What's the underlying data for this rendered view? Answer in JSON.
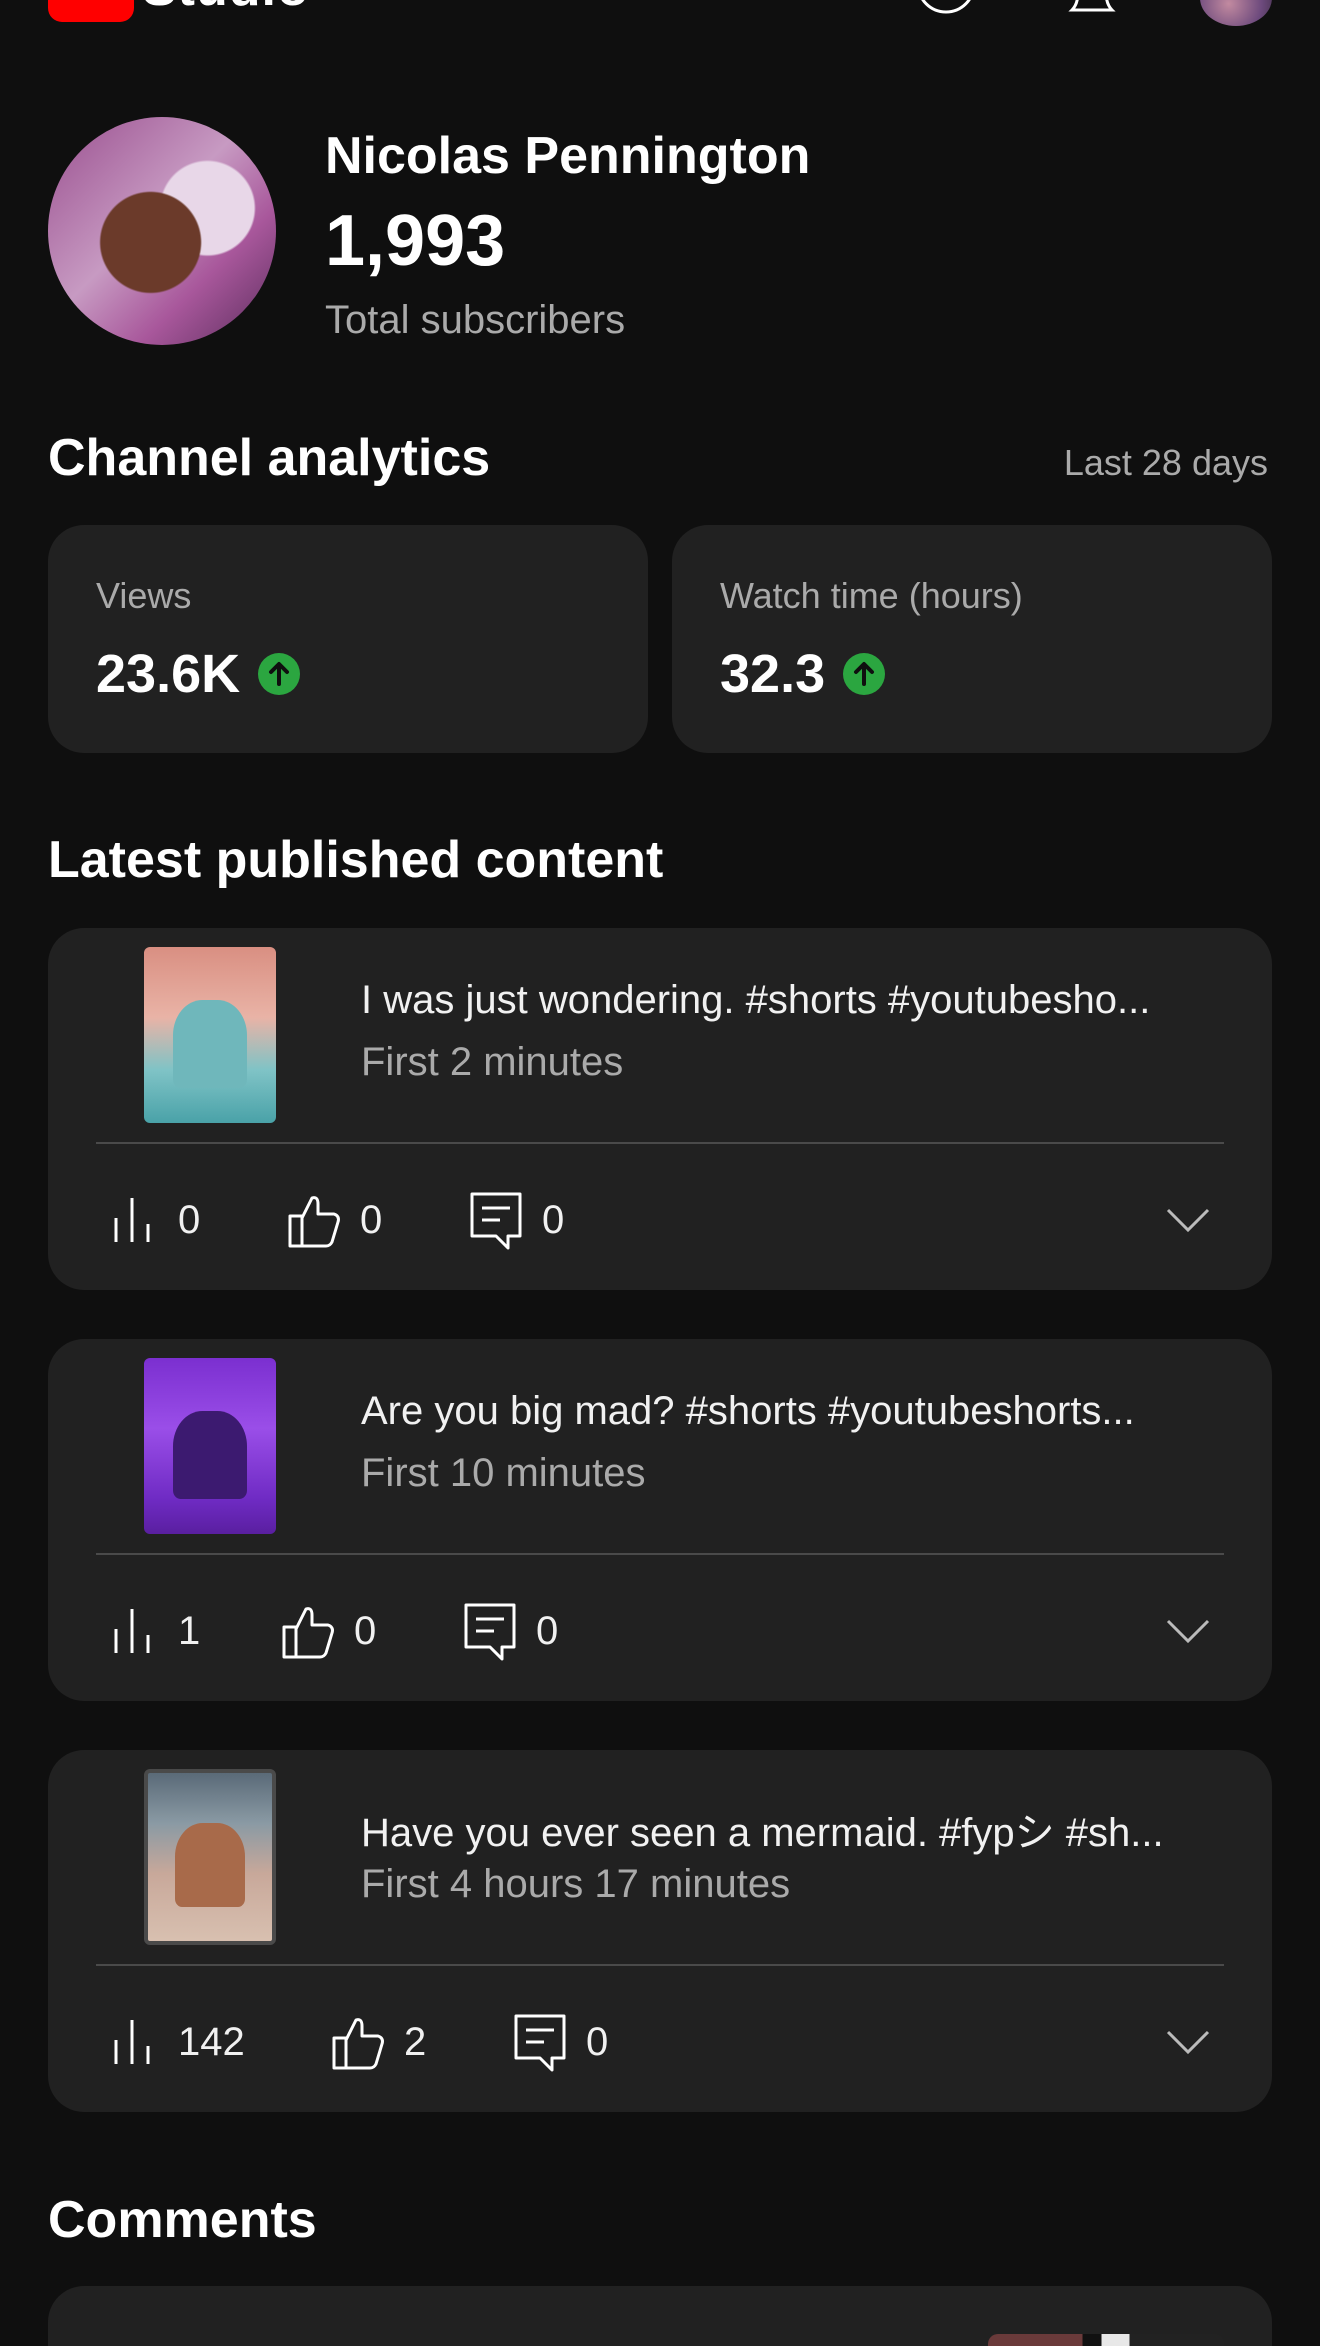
{
  "app": {
    "logo_text": "Studio"
  },
  "channel": {
    "name": "Nicolas Pennington",
    "subscribers": "1,993",
    "subscribers_label": "Total subscribers"
  },
  "analytics": {
    "title": "Channel analytics",
    "period": "Last 28 days",
    "stats": [
      {
        "label": "Views",
        "value": "23.6K",
        "trend": "up"
      },
      {
        "label": "Watch time (hours)",
        "value": "32.3",
        "trend": "up"
      }
    ],
    "trend_color": "#2ba640"
  },
  "latest": {
    "title": "Latest published content",
    "videos": [
      {
        "title": "I was just wondering. #shorts #youtubesho...",
        "subtitle": "First 2 minutes",
        "views": "0",
        "likes": "0",
        "comments": "0"
      },
      {
        "title": "Are you big mad? #shorts #youtubeshorts...",
        "subtitle": "First 10 minutes",
        "views": "1",
        "likes": "0",
        "comments": "0"
      },
      {
        "title": "Have you ever seen a mermaid. #fypシ #sh...",
        "subtitle": "First 4 hours 17 minutes",
        "views": "142",
        "likes": "2",
        "comments": "0"
      }
    ]
  },
  "comments": {
    "title": "Comments"
  },
  "icons": {
    "create": "create-icon",
    "notifications": "bell-icon",
    "views": "bar-chart-icon",
    "likes": "thumbs-up-icon",
    "comments": "comment-icon",
    "expand": "chevron-down-icon",
    "trend": "arrow-up-circle-icon"
  }
}
